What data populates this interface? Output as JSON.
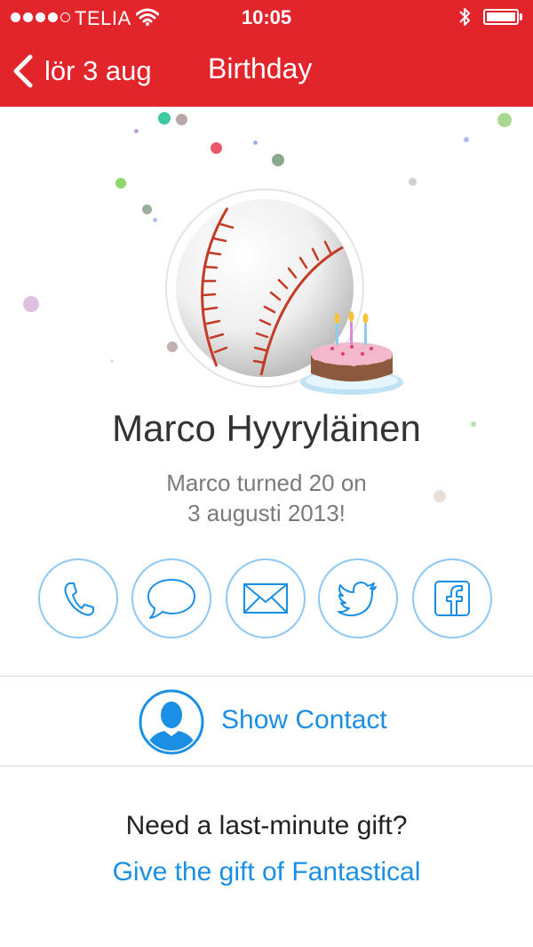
{
  "status_bar": {
    "carrier": "TELIA",
    "time": "10:05",
    "signal_icon": "signal-dots-icon",
    "wifi_icon": "wifi-icon",
    "bluetooth_icon": "bluetooth-icon",
    "battery_icon": "battery-icon",
    "battery_level": 1.0
  },
  "nav": {
    "back_label": "lör 3 aug",
    "back_icon": "chevron-left-icon",
    "title": "Birthday"
  },
  "colors": {
    "nav_background": "#e2242b",
    "accent_blue": "#1a8fe3",
    "action_border": "#8ec8f3"
  },
  "profile": {
    "avatar_icon": "baseball-avatar",
    "badge_icon": "birthday-cake-icon",
    "name": "Marco Hyyryläinen",
    "message_line1": "Marco turned 20 on",
    "message_line2": "3 augusti 2013!"
  },
  "actions": [
    {
      "icon": "phone-icon"
    },
    {
      "icon": "message-icon"
    },
    {
      "icon": "mail-icon"
    },
    {
      "icon": "twitter-icon"
    },
    {
      "icon": "facebook-icon"
    }
  ],
  "contact": {
    "icon": "contact-person-icon",
    "label": "Show Contact"
  },
  "gift": {
    "question": "Need a last-minute gift?",
    "link": "Give the gift of Fantastical"
  }
}
